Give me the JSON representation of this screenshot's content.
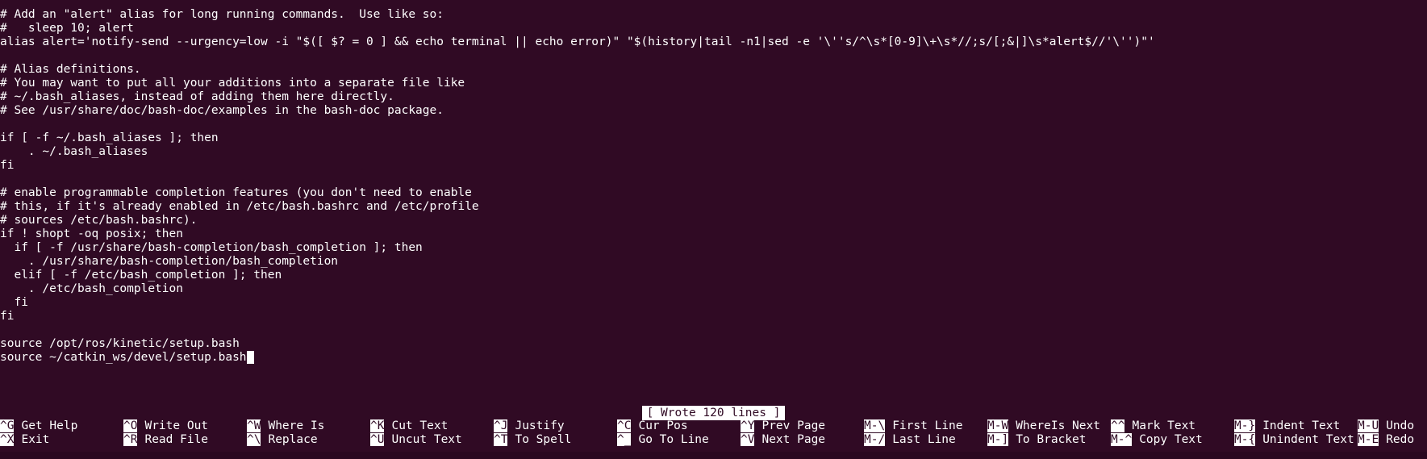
{
  "editor": {
    "lines": [
      "# Add an \"alert\" alias for long running commands.  Use like so:",
      "#   sleep 10; alert",
      "alias alert='notify-send --urgency=low -i \"$([ $? = 0 ] && echo terminal || echo error)\" \"$(history|tail -n1|sed -e '\\''s/^\\s*[0-9]\\+\\s*//;s/[;&|]\\s*alert$//'\\'')\"'",
      "",
      "# Alias definitions.",
      "# You may want to put all your additions into a separate file like",
      "# ~/.bash_aliases, instead of adding them here directly.",
      "# See /usr/share/doc/bash-doc/examples in the bash-doc package.",
      "",
      "if [ -f ~/.bash_aliases ]; then",
      "    . ~/.bash_aliases",
      "fi",
      "",
      "# enable programmable completion features (you don't need to enable",
      "# this, if it's already enabled in /etc/bash.bashrc and /etc/profile",
      "# sources /etc/bash.bashrc).",
      "if ! shopt -oq posix; then",
      "  if [ -f /usr/share/bash-completion/bash_completion ]; then",
      "    . /usr/share/bash-completion/bash_completion",
      "  elif [ -f /etc/bash_completion ]; then",
      "    . /etc/bash_completion",
      "  fi",
      "fi",
      "",
      "source /opt/ros/kinetic/setup.bash",
      "source ~/catkin_ws/devel/setup.bash"
    ]
  },
  "status": {
    "message": "[ Wrote 120 lines ]"
  },
  "shortcuts": {
    "row1": [
      {
        "key": "^G",
        "label": "Get Help"
      },
      {
        "key": "^O",
        "label": "Write Out"
      },
      {
        "key": "^W",
        "label": "Where Is"
      },
      {
        "key": "^K",
        "label": "Cut Text"
      },
      {
        "key": "^J",
        "label": "Justify"
      },
      {
        "key": "^C",
        "label": "Cur Pos"
      },
      {
        "key": "^Y",
        "label": "Prev Page"
      },
      {
        "key": "M-\\",
        "label": "First Line"
      },
      {
        "key": "M-W",
        "label": "WhereIs Next"
      },
      {
        "key": "^^",
        "label": "Mark Text"
      },
      {
        "key": "M-}",
        "label": "Indent Text"
      },
      {
        "key": "M-U",
        "label": "Undo"
      }
    ],
    "row2": [
      {
        "key": "^X",
        "label": "Exit"
      },
      {
        "key": "^R",
        "label": "Read File"
      },
      {
        "key": "^\\",
        "label": "Replace"
      },
      {
        "key": "^U",
        "label": "Uncut Text"
      },
      {
        "key": "^T",
        "label": "To Spell"
      },
      {
        "key": "^_",
        "label": "Go To Line"
      },
      {
        "key": "^V",
        "label": "Next Page"
      },
      {
        "key": "M-/",
        "label": "Last Line"
      },
      {
        "key": "M-]",
        "label": "To Bracket"
      },
      {
        "key": "M-^",
        "label": "Copy Text"
      },
      {
        "key": "M-{",
        "label": "Unindent Text"
      },
      {
        "key": "M-E",
        "label": "Redo"
      }
    ]
  },
  "colors": {
    "background": "#300a24",
    "foreground": "#ffffff"
  }
}
